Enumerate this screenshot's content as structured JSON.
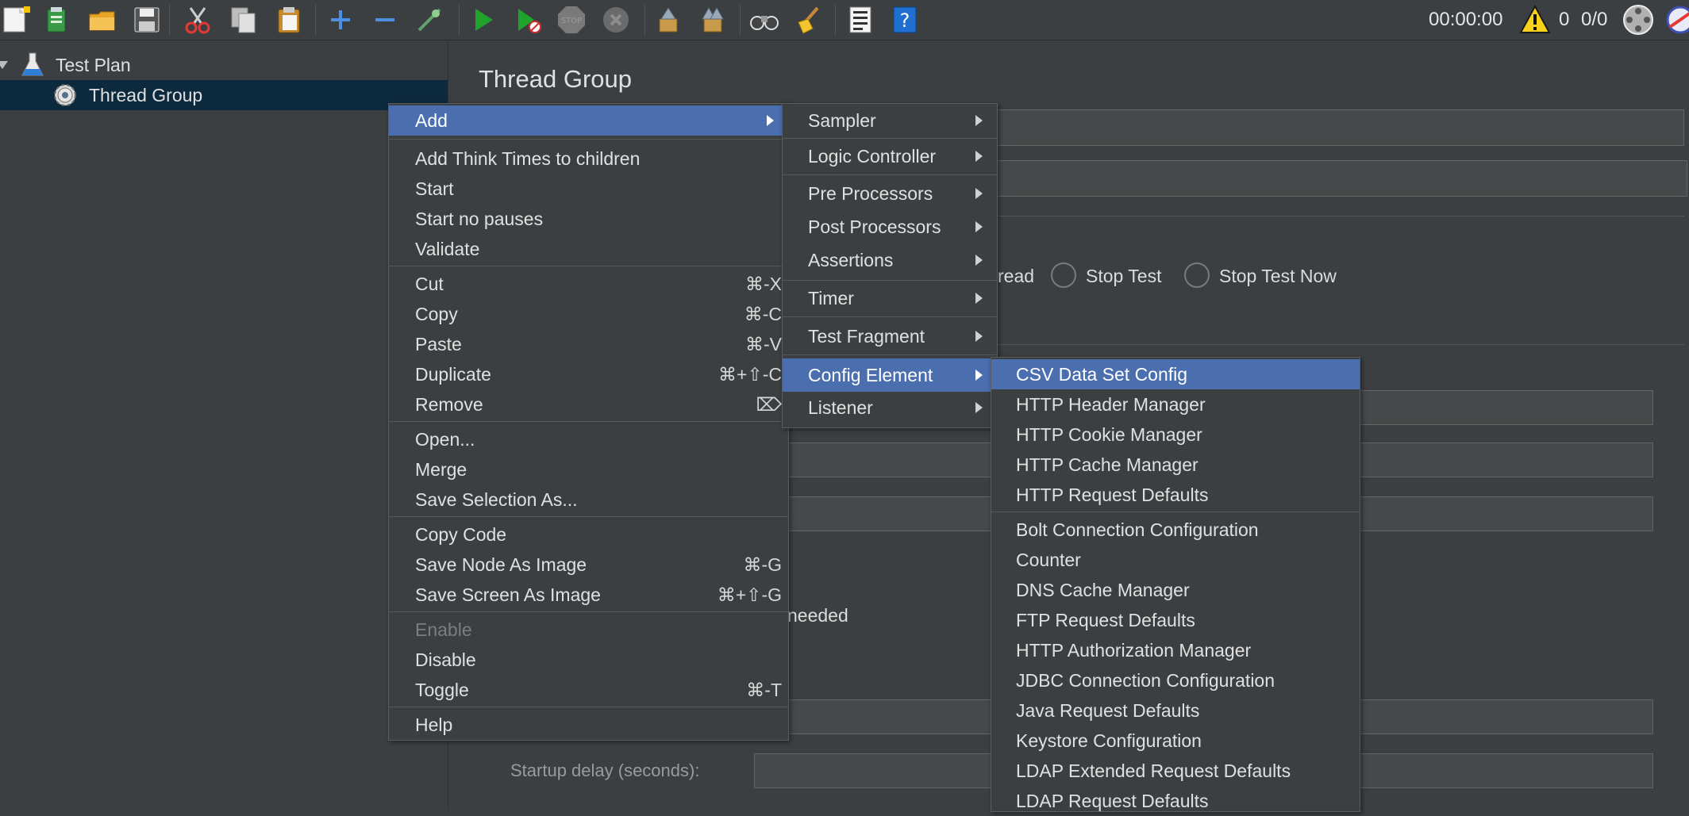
{
  "toolbar": {
    "timer": "00:00:00",
    "error_count": "0",
    "thread_count": "0/0"
  },
  "tree": {
    "items": [
      {
        "label": "Test Plan"
      },
      {
        "label": "Thread Group"
      }
    ]
  },
  "panel": {
    "title": "Thread Group",
    "fragment_read": "read",
    "stop_test": "Stop Test",
    "stop_test_now": "Stop Test Now",
    "fragment_needed": "needed",
    "startup_delay_label": "Startup delay (seconds):"
  },
  "context_menu": {
    "add": "Add",
    "add_think_times": "Add Think Times to children",
    "start": "Start",
    "start_no_pauses": "Start no pauses",
    "validate": "Validate",
    "cut": "Cut",
    "cut_shortcut": "⌘-X",
    "copy": "Copy",
    "copy_shortcut": "⌘-C",
    "paste": "Paste",
    "paste_shortcut": "⌘-V",
    "duplicate": "Duplicate",
    "duplicate_shortcut": "⌘+⇧-C",
    "remove": "Remove",
    "remove_shortcut": "⌦",
    "open": "Open...",
    "merge": "Merge",
    "save_selection_as": "Save Selection As...",
    "copy_code": "Copy Code",
    "save_node_as_image": "Save Node As Image",
    "save_node_shortcut": "⌘-G",
    "save_screen_as_image": "Save Screen As Image",
    "save_screen_shortcut": "⌘+⇧-G",
    "enable": "Enable",
    "disable": "Disable",
    "toggle": "Toggle",
    "toggle_shortcut": "⌘-T",
    "help": "Help"
  },
  "add_menu": {
    "sampler": "Sampler",
    "logic_controller": "Logic Controller",
    "pre_processors": "Pre Processors",
    "post_processors": "Post Processors",
    "assertions": "Assertions",
    "timer": "Timer",
    "test_fragment": "Test Fragment",
    "config_element": "Config Element",
    "listener": "Listener"
  },
  "config_menu": {
    "items": [
      "CSV Data Set Config",
      "HTTP Header Manager",
      "HTTP Cookie Manager",
      "HTTP Cache Manager",
      "HTTP Request Defaults",
      "Bolt Connection Configuration",
      "Counter",
      "DNS Cache Manager",
      "FTP Request Defaults",
      "HTTP Authorization Manager",
      "JDBC Connection Configuration",
      "Java Request Defaults",
      "Keystore Configuration",
      "LDAP Extended Request Defaults",
      "LDAP Request Defaults"
    ]
  },
  "colors": {
    "background": "#3c3f41",
    "menu_highlight": "#4b6eaf",
    "tree_selection": "#0d293e",
    "disabled_text": "#7d7d7d"
  }
}
